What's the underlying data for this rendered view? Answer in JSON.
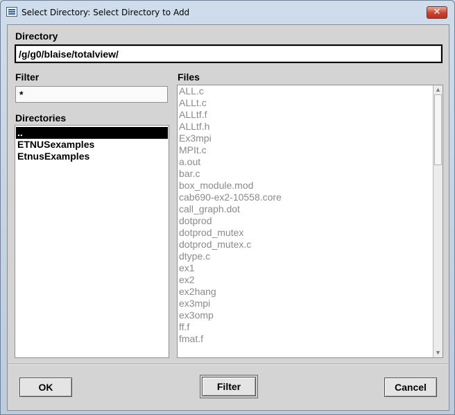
{
  "window": {
    "title": "Select Directory: Select Directory to Add",
    "close_glyph": "✕"
  },
  "directory": {
    "label": "Directory",
    "value": "/g/g0/blaise/totalview/"
  },
  "filter": {
    "label": "Filter",
    "value": "*"
  },
  "directories": {
    "label": "Directories",
    "items": [
      {
        "label": "..",
        "selected": true
      },
      {
        "label": "ETNUSexamples",
        "selected": false
      },
      {
        "label": "EtnusExamples",
        "selected": false
      }
    ]
  },
  "files": {
    "label": "Files",
    "items": [
      "ALL.c",
      "ALLt.c",
      "ALLtf.f",
      "ALLtf.h",
      "Ex3mpi",
      "MPIt.c",
      "a.out",
      "bar.c",
      "box_module.mod",
      "cab690-ex2-10558.core",
      "call_graph.dot",
      "dotprod",
      "dotprod_mutex",
      "dotprod_mutex.c",
      "dtype.c",
      "ex1",
      "ex2",
      "ex2hang",
      "ex3mpi",
      "ex3omp",
      "ff.f",
      "fmat.f"
    ]
  },
  "buttons": {
    "ok": "OK",
    "filter": "Filter",
    "cancel": "Cancel"
  }
}
